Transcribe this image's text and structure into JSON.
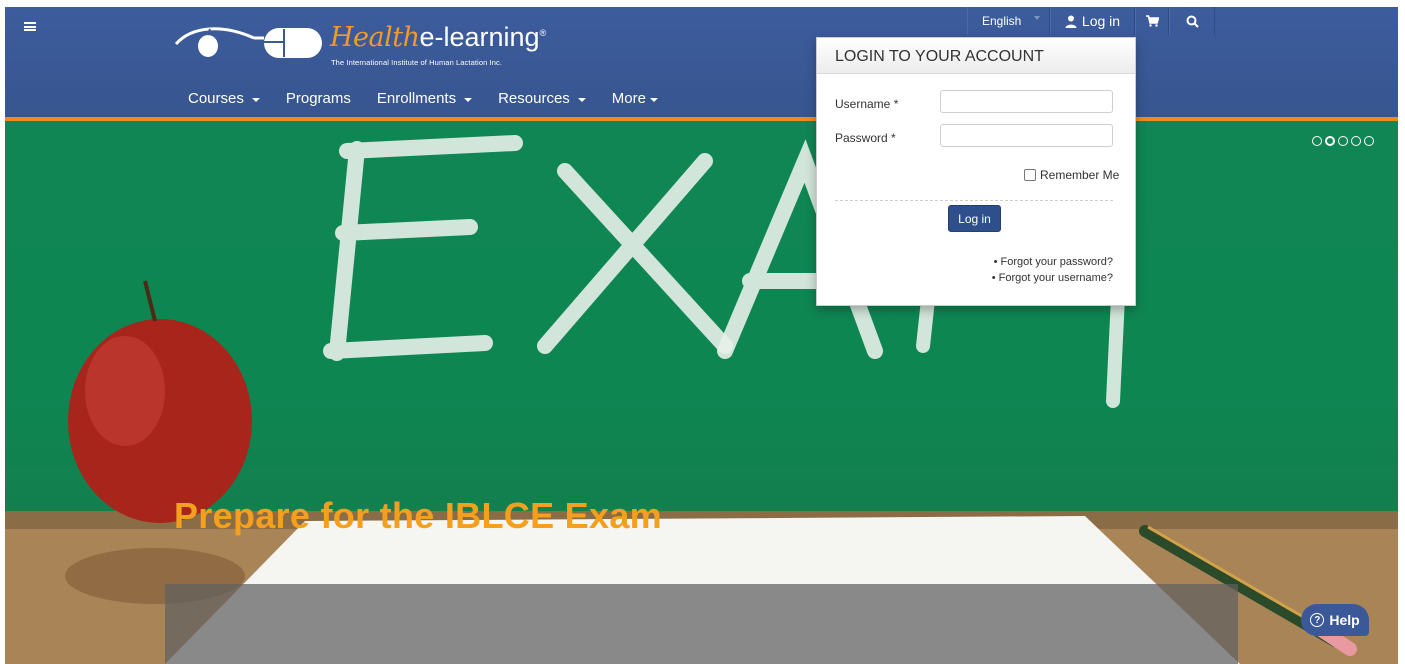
{
  "header": {
    "logo": {
      "word_script": "Health",
      "word_main": "e-learning",
      "reg_mark": "®",
      "tagline": "The International Institute of Human Lactation Inc."
    },
    "nav": [
      {
        "label": "Courses",
        "dropdown": true
      },
      {
        "label": "Programs",
        "dropdown": false
      },
      {
        "label": "Enrollments",
        "dropdown": true
      },
      {
        "label": "Resources",
        "dropdown": true
      },
      {
        "label": "More",
        "dropdown": true
      }
    ],
    "colors": {
      "background": "#3b5998",
      "accent_rule": "#f08a24"
    }
  },
  "topbar": {
    "language": "English",
    "login_label": "Log in",
    "icons": [
      "user-icon",
      "cart-icon",
      "search-icon"
    ]
  },
  "login_panel": {
    "title": "LOGIN TO YOUR ACCOUNT",
    "username_label": "Username *",
    "username_value": "",
    "password_label": "Password *",
    "password_value": "",
    "remember_label": "Remember Me",
    "remember_checked": false,
    "submit_label": "Log in",
    "links": [
      "Forgot your password?",
      "Forgot your username?"
    ]
  },
  "hero": {
    "caption": "Prepare for the IBLCE Exam",
    "slide_count": 5,
    "active_slide": 2,
    "caption_color": "#f4a01e"
  },
  "help_button": {
    "label": "Help"
  }
}
